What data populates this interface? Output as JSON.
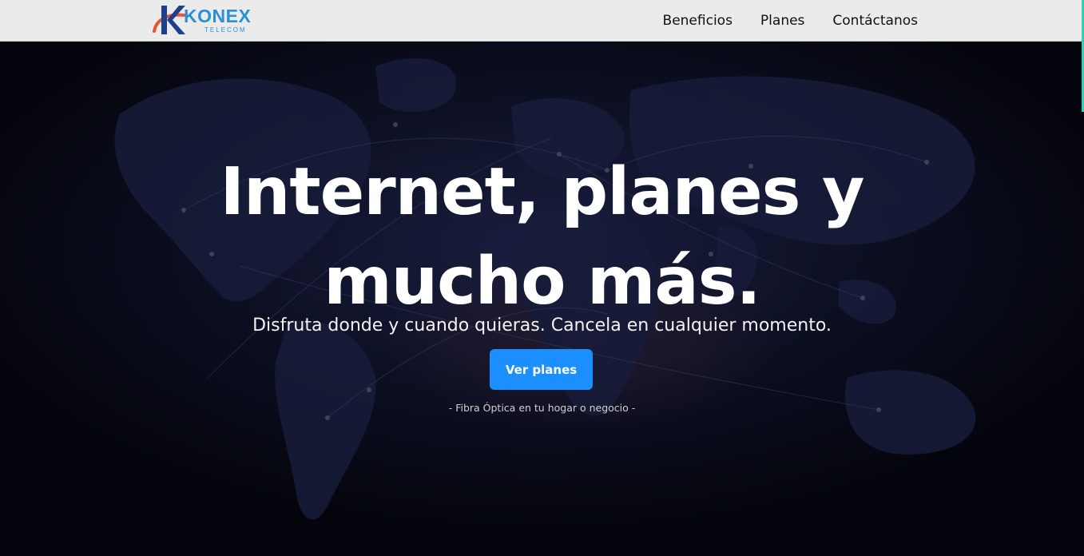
{
  "brand": {
    "name": "KONEX",
    "tagline": "TELECOM",
    "mark_letter": "K",
    "primary_color": "#2b8fd6",
    "accent_color": "#e8552a"
  },
  "nav": {
    "items": [
      {
        "label": "Beneficios"
      },
      {
        "label": "Planes"
      },
      {
        "label": "Contáctanos"
      }
    ]
  },
  "hero": {
    "title_line1": "Internet, planes y",
    "title_line2": "mucho más.",
    "subtitle": "Disfruta donde y cuando quieras. Cancela en cualquier momento.",
    "cta_label": "Ver planes",
    "cta_color": "#1b8fff",
    "note": "- Fibra Óptica en tu hogar o negocio -",
    "background_icon": "world-map"
  }
}
